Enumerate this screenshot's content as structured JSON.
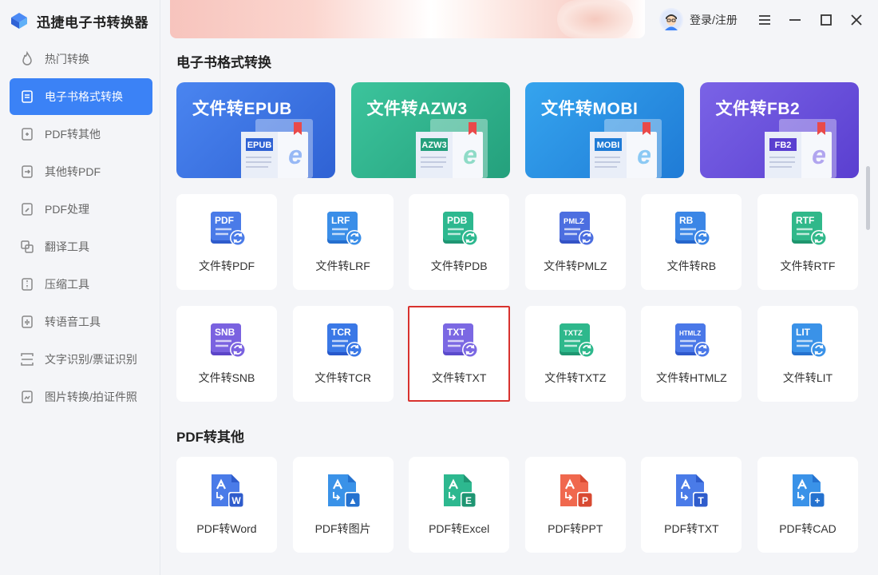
{
  "app": {
    "title": "迅捷电子书转换器"
  },
  "sidebar": {
    "items": [
      {
        "label": "热门转换",
        "icon": "fire-icon"
      },
      {
        "label": "电子书格式转换",
        "icon": "ebook-icon"
      },
      {
        "label": "PDF转其他",
        "icon": "pdf-convert-icon"
      },
      {
        "label": "其他转PDF",
        "icon": "to-pdf-icon"
      },
      {
        "label": "PDF处理",
        "icon": "pdf-edit-icon"
      },
      {
        "label": "翻译工具",
        "icon": "translate-icon"
      },
      {
        "label": "压缩工具",
        "icon": "compress-icon"
      },
      {
        "label": "转语音工具",
        "icon": "voice-icon"
      },
      {
        "label": "文字识别/票证识别",
        "icon": "ocr-icon"
      },
      {
        "label": "图片转换/拍证件照",
        "icon": "image-icon"
      }
    ],
    "active_index": 1
  },
  "header": {
    "login_label": "登录/注册"
  },
  "sections": {
    "ebook_title": "电子书格式转换",
    "pdf_title": "PDF转其他"
  },
  "featured": [
    {
      "title": "文件转EPUB",
      "book_label": "EPUB"
    },
    {
      "title": "文件转AZW3",
      "book_label": "AZW3"
    },
    {
      "title": "文件转MOBI",
      "book_label": "MOBI"
    },
    {
      "title": "文件转FB2",
      "book_label": "FB2"
    }
  ],
  "ebook_tools_row1": [
    {
      "label": "文件转PDF",
      "tag": "PDF"
    },
    {
      "label": "文件转LRF",
      "tag": "LRF"
    },
    {
      "label": "文件转PDB",
      "tag": "PDB"
    },
    {
      "label": "文件转PMLZ",
      "tag": "PMLZ"
    },
    {
      "label": "文件转RB",
      "tag": "RB"
    },
    {
      "label": "文件转RTF",
      "tag": "RTF"
    }
  ],
  "ebook_tools_row2": [
    {
      "label": "文件转SNB",
      "tag": "SNB"
    },
    {
      "label": "文件转TCR",
      "tag": "TCR"
    },
    {
      "label": "文件转TXT",
      "tag": "TXT"
    },
    {
      "label": "文件转TXTZ",
      "tag": "TXTZ"
    },
    {
      "label": "文件转HTMLZ",
      "tag": "HTMLZ"
    },
    {
      "label": "文件转LIT",
      "tag": "LIT"
    }
  ],
  "pdf_tools": [
    {
      "label": "PDF转Word",
      "badge": "W"
    },
    {
      "label": "PDF转图片",
      "badge": "▲"
    },
    {
      "label": "PDF转Excel",
      "badge": "E"
    },
    {
      "label": "PDF转PPT",
      "badge": "P"
    },
    {
      "label": "PDF转TXT",
      "badge": "T"
    },
    {
      "label": "PDF转CAD",
      "badge": "+"
    }
  ],
  "colors": {
    "accent": "#3b82f6",
    "selected_border": "#d8322e",
    "epub_card": "#3f74e6",
    "azw3_card": "#2db58f",
    "mobi_card": "#2a8fe0",
    "fb2_card": "#6b55db"
  }
}
